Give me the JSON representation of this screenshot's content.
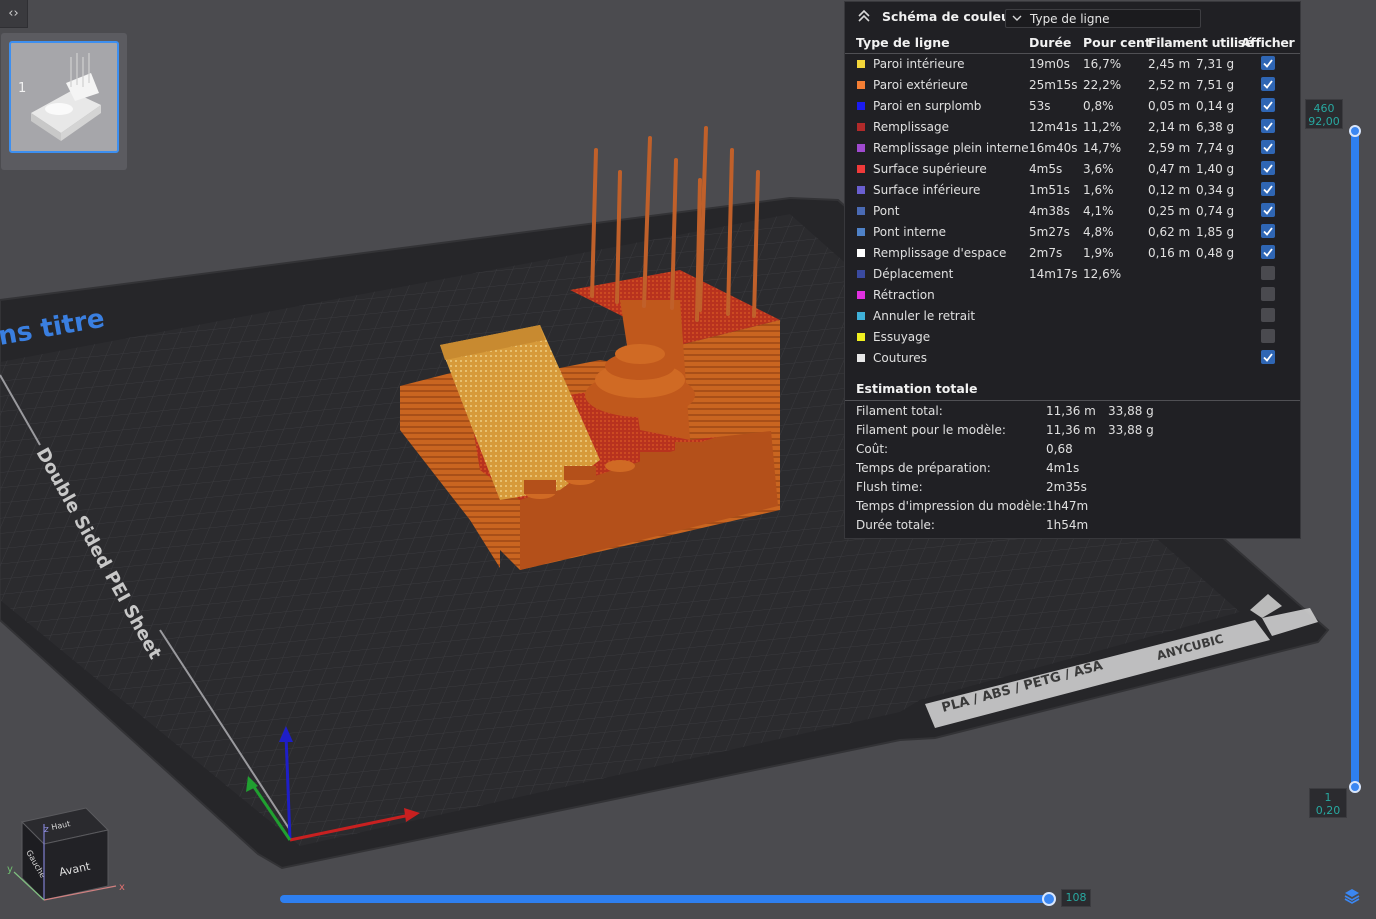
{
  "plate": {
    "number": "1"
  },
  "bed": {
    "title": "ns titre",
    "sheet_label": "Double Sided PEI Sheet",
    "materials_label": "PLA / ABS / PETG / ASA",
    "brand": "ANYCUBIC"
  },
  "legend": {
    "title": "Schéma de couleur",
    "view_type": "Type de ligne",
    "columns": {
      "type": "Type de ligne",
      "duration": "Durée",
      "percent": "Pour cent",
      "filament": "Filament utilisé",
      "show": "Afficher"
    },
    "rows": [
      {
        "color": "#f3d63a",
        "name": "Paroi intérieure",
        "duration": "19m0s",
        "percent": "16,7%",
        "length": "2,45 m",
        "weight": "7,31 g",
        "checked": true
      },
      {
        "color": "#f47e34",
        "name": "Paroi extérieure",
        "duration": "25m15s",
        "percent": "22,2%",
        "length": "2,52 m",
        "weight": "7,51 g",
        "checked": true
      },
      {
        "color": "#1b1bf0",
        "name": "Paroi en surplomb",
        "duration": "53s",
        "percent": "0,8%",
        "length": "0,05 m",
        "weight": "0,14 g",
        "checked": true
      },
      {
        "color": "#b12a2a",
        "name": "Remplissage",
        "duration": "12m41s",
        "percent": "11,2%",
        "length": "2,14 m",
        "weight": "6,38 g",
        "checked": true
      },
      {
        "color": "#a04ad0",
        "name": "Remplissage plein interne",
        "duration": "16m40s",
        "percent": "14,7%",
        "length": "2,59 m",
        "weight": "7,74 g",
        "checked": true
      },
      {
        "color": "#f03a3a",
        "name": "Surface supérieure",
        "duration": "4m5s",
        "percent": "3,6%",
        "length": "0,47 m",
        "weight": "1,40 g",
        "checked": true
      },
      {
        "color": "#6a5fd0",
        "name": "Surface inférieure",
        "duration": "1m51s",
        "percent": "1,6%",
        "length": "0,12 m",
        "weight": "0,34 g",
        "checked": true
      },
      {
        "color": "#4a6ab4",
        "name": "Pont",
        "duration": "4m38s",
        "percent": "4,1%",
        "length": "0,25 m",
        "weight": "0,74 g",
        "checked": true
      },
      {
        "color": "#4f82c8",
        "name": "Pont interne",
        "duration": "5m27s",
        "percent": "4,8%",
        "length": "0,62 m",
        "weight": "1,85 g",
        "checked": true
      },
      {
        "color": "#ffffff",
        "name": "Remplissage d'espace",
        "duration": "2m7s",
        "percent": "1,9%",
        "length": "0,16 m",
        "weight": "0,48 g",
        "checked": true
      },
      {
        "color": "#3a4aa0",
        "name": "Déplacement",
        "duration": "14m17s",
        "percent": "12,6%",
        "length": "",
        "weight": "",
        "checked": false
      },
      {
        "color": "#e030e0",
        "name": "Rétraction",
        "duration": "",
        "percent": "",
        "length": "",
        "weight": "",
        "checked": false
      },
      {
        "color": "#3fb0d8",
        "name": "Annuler le retrait",
        "duration": "",
        "percent": "",
        "length": "",
        "weight": "",
        "checked": false
      },
      {
        "color": "#f0f020",
        "name": "Essuyage",
        "duration": "",
        "percent": "",
        "length": "",
        "weight": "",
        "checked": false
      },
      {
        "color": "#e8e8e8",
        "name": "Coutures",
        "duration": "",
        "percent": "",
        "length": "",
        "weight": "",
        "checked": true
      }
    ],
    "summary_title": "Estimation totale",
    "summary": [
      {
        "label": "Filament total:",
        "v1": "11,36 m",
        "v2": "33,88 g"
      },
      {
        "label": "Filament pour le modèle:",
        "v1": "11,36 m",
        "v2": "33,88 g"
      },
      {
        "label": "Coût:",
        "v1": "0,68",
        "v2": ""
      },
      {
        "label": "Temps de préparation:",
        "v1": "4m1s",
        "v2": ""
      },
      {
        "label": "Flush time:",
        "v1": "2m35s",
        "v2": ""
      },
      {
        "label": "Temps d'impression du modèle:",
        "v1": "1h47m",
        "v2": ""
      },
      {
        "label": "Durée totale:",
        "v1": "1h54m",
        "v2": ""
      }
    ]
  },
  "layer_slider": {
    "top_layer": "460",
    "top_height": "92,00",
    "bottom_layer": "1",
    "bottom_height": "0,20"
  },
  "move_slider": {
    "value": "108"
  },
  "view_cube": {
    "top": "Haut",
    "front": "Avant",
    "left": "Gauche",
    "axis_x": "x",
    "axis_y": "y",
    "axis_z": "z"
  },
  "colors": {
    "accent": "#2e7ff0",
    "value_text": "#28a8a0",
    "model": "#c9601e"
  }
}
